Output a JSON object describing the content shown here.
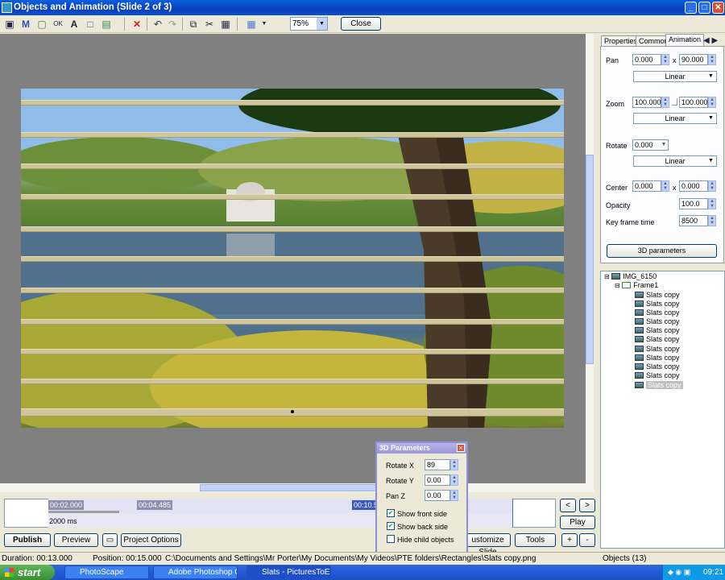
{
  "window": {
    "title": "Objects and Animation  (Slide 2 of 3)"
  },
  "toolbar": {
    "zoom": "75%",
    "close_label": "Close"
  },
  "timeline": {
    "markers": [
      "00:02.000",
      "00:04.485",
      "00:10.5"
    ],
    "duration_label": "2000 ms",
    "nav_prev": "<",
    "nav_next": ">",
    "play": "Play",
    "plus": "+",
    "minus": "-"
  },
  "bottom_buttons": {
    "publish": "Publish",
    "preview": "Preview",
    "project_options": "Project Options",
    "customize_slide": "ustomize Slide",
    "tools": "Tools"
  },
  "panel": {
    "tabs": [
      "Properties",
      "Common",
      "Animation"
    ],
    "pan_label": "Pan",
    "pan_x": "0.000",
    "pan_y": "90.000",
    "pan_mode": "Linear",
    "zoom_label": "Zoom",
    "zoom_x": "100.000",
    "zoom_y": "100.000",
    "zoom_mode": "Linear",
    "rotate_label": "Rotate",
    "rotate_val": "0.000",
    "rotate_mode": "Linear",
    "center_label": "Center",
    "center_x": "0.000",
    "center_y": "0.000",
    "opacity_label": "Opacity",
    "opacity_val": "100.0",
    "keyframe_label": "Key frame time",
    "keyframe_val": "8500",
    "params_btn": "3D parameters"
  },
  "tree": {
    "root": "IMG_6150",
    "frame": "Frame1",
    "items": [
      "Slats copy",
      "Slats copy",
      "Slats copy",
      "Slats copy",
      "Slats copy",
      "Slats copy",
      "Slats copy",
      "Slats copy",
      "Slats copy",
      "Slats copy",
      "Slats copy"
    ]
  },
  "dialog": {
    "title": "3D Parameters",
    "rx_label": "Rotate X",
    "rx": "89",
    "ry_label": "Rotate Y",
    "ry": "0.00",
    "pz_label": "Pan Z",
    "pz": "0.00",
    "front": "Show front side",
    "back": "Show back side",
    "hide": "Hide child objects"
  },
  "status": {
    "duration": "Duration:  00:13.000",
    "position": "Position:  00:15.000",
    "path": "C:\\Documents and Settings\\Mr Porter\\My Documents\\My Videos\\PTE folders\\Rectangles\\Slats copy.png",
    "objects": "Objects (13)"
  },
  "taskbar": {
    "start": "start",
    "tasks": [
      "PhotoScape",
      "Adobe Photoshop CS...",
      "Slats - PicturesToExe ..."
    ],
    "clock": "09:21"
  }
}
